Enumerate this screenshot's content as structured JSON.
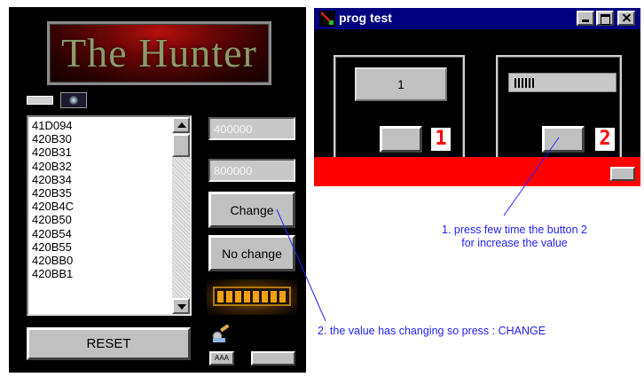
{
  "hunter": {
    "logo_text": "The Hunter",
    "list_items": [
      "41D094",
      "420B30",
      "420B31",
      "420B32",
      "420B34",
      "420B35",
      "420B4C",
      "420B50",
      "420B54",
      "420B55",
      "420BB0",
      "420BB1"
    ],
    "field1_value": "400000",
    "field2_value": "800000",
    "change_label": "Change",
    "no_change_label": "No change",
    "reset_label": "RESET",
    "tiny_button_label": "AAA",
    "icons": [
      "camera-icon",
      "key-icon",
      "scroll-up-icon",
      "scroll-down-icon"
    ]
  },
  "prog": {
    "title": "prog test",
    "value_display": "1",
    "label1": "1",
    "label2": "2",
    "colors": {
      "titlebar": "#000080",
      "band": "#ff0000",
      "labels": "#ff0000"
    }
  },
  "annotations": {
    "note1_line1": "1. press few time the button 2",
    "note1_line2": "for increase the value",
    "note2": "2. the value has changing so press : CHANGE",
    "color": "#2323ff"
  }
}
